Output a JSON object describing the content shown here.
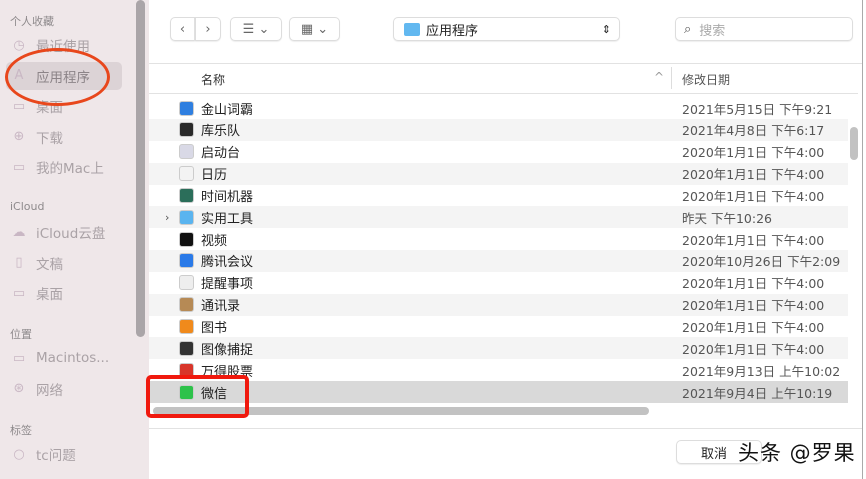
{
  "sidebar": {
    "sections": [
      {
        "title": "个人收藏",
        "items": [
          {
            "label": "最近使用",
            "icon": "clock-icon"
          },
          {
            "label": "应用程序",
            "icon": "apps-icon",
            "selected": true
          },
          {
            "label": "桌面",
            "icon": "desktop-icon"
          },
          {
            "label": "下载",
            "icon": "download-icon"
          },
          {
            "label": "我的Mac上",
            "icon": "folder-icon"
          }
        ]
      },
      {
        "title": "iCloud",
        "items": [
          {
            "label": "iCloud云盘",
            "icon": "cloud-icon"
          },
          {
            "label": "文稿",
            "icon": "document-icon"
          },
          {
            "label": "桌面",
            "icon": "desktop-icon"
          }
        ]
      },
      {
        "title": "位置",
        "items": [
          {
            "label": "Macintos...",
            "icon": "disk-icon"
          },
          {
            "label": "网络",
            "icon": "globe-icon"
          }
        ]
      },
      {
        "title": "标签",
        "items": [
          {
            "label": "tc问题",
            "icon": "tag-circle-icon"
          }
        ]
      }
    ]
  },
  "toolbar": {
    "back": "‹",
    "forward": "›",
    "list_view": "☰ ⌄",
    "group_view": "▦ ⌄",
    "location": "应用程序",
    "search_placeholder": "搜索"
  },
  "columns": {
    "name": "名称",
    "date": "修改日期"
  },
  "rows": [
    {
      "name": "金山词霸",
      "date": "2021年5月15日 下午9:21",
      "color": "#2f7fe0"
    },
    {
      "name": "库乐队",
      "date": "2021年4月8日 下午6:17",
      "color": "#2a2a2a"
    },
    {
      "name": "启动台",
      "date": "2020年1月1日 下午4:00",
      "color": "#d9d9e6"
    },
    {
      "name": "日历",
      "date": "2020年1月1日 下午4:00",
      "color": "#f3f3f3"
    },
    {
      "name": "时间机器",
      "date": "2020年1月1日 下午4:00",
      "color": "#2b6e5a"
    },
    {
      "name": "实用工具",
      "date": "昨天 下午10:26",
      "color": "#5ab4ef",
      "folder": true
    },
    {
      "name": "视频",
      "date": "2020年1月1日 下午4:00",
      "color": "#111111"
    },
    {
      "name": "腾讯会议",
      "date": "2020年10月26日 下午2:09",
      "color": "#2a7ae8"
    },
    {
      "name": "提醒事项",
      "date": "2020年1月1日 下午4:00",
      "color": "#eeeeee"
    },
    {
      "name": "通讯录",
      "date": "2020年1月1日 下午4:00",
      "color": "#b68a55"
    },
    {
      "name": "图书",
      "date": "2020年1月1日 下午4:00",
      "color": "#f08a1c"
    },
    {
      "name": "图像捕捉",
      "date": "2020年1月1日 下午4:00",
      "color": "#333333"
    },
    {
      "name": "万得股票",
      "date": "2021年9月13日 上午10:02",
      "color": "#d8352a"
    },
    {
      "name": "微信",
      "date": "2021年9月4日 上午10:19",
      "color": "#2dc24a",
      "selected": true
    }
  ],
  "footer": {
    "cancel": "取消"
  },
  "watermark": "头条 @罗果"
}
